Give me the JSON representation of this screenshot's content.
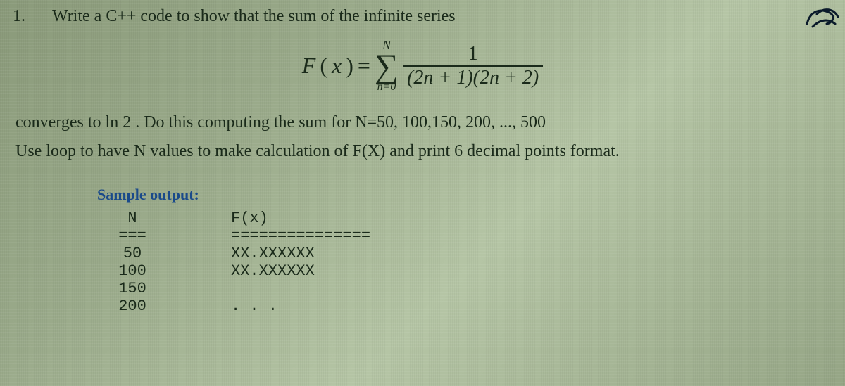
{
  "question": {
    "number": "1.",
    "prompt": "Write a C++ code to show that the sum of the infinite series"
  },
  "formula": {
    "lhs_f": "F",
    "lhs_paren_open": "(",
    "lhs_x": "x",
    "lhs_paren_close": ")",
    "eq": " = ",
    "sigma_upper": "N",
    "sigma_symbol": "∑",
    "sigma_lower": "n=0",
    "numerator": "1",
    "denominator": "(2n + 1)(2n + 2)"
  },
  "body": {
    "line1_a": "converges to ",
    "line1_ln": "ln 2",
    "line1_b": " . Do this computing the sum for N=50, 100,150, 200, ..., 500",
    "line2": "Use loop to have N values to make calculation of F(X) and print 6 decimal points format."
  },
  "sample": {
    "title": "Sample output:",
    "header": {
      "n": "N",
      "fx": "F(x)"
    },
    "sep": {
      "n": "===",
      "fx": "==============="
    },
    "rows": [
      {
        "n": "50",
        "fx": "XX.XXXXXX"
      },
      {
        "n": "100",
        "fx": "XX.XXXXXX"
      },
      {
        "n": "150",
        "fx": ""
      },
      {
        "n": "200",
        "fx": ". . ."
      }
    ]
  }
}
